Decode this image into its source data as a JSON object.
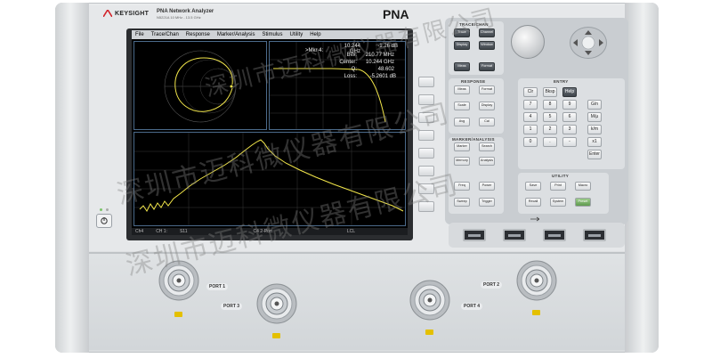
{
  "header": {
    "brand": "KEYSIGHT",
    "product": "PNA Network Analyzer",
    "model_line": "N5221A  10 MHz - 13.5 GHz",
    "badge": "PNA"
  },
  "menu": [
    "File",
    "Trace/Chan",
    "Response",
    "Marker/Analysis",
    "Stimulus",
    "Utility",
    "Help"
  ],
  "markers": {
    "title": ">Mkr 4:",
    "rows": [
      {
        "label": "",
        "value": "10.244 GHz",
        "extra": "-1.26 dB"
      },
      {
        "label": "BW:",
        "value": "210.77 MHz"
      },
      {
        "label": "Center:",
        "value": "10.244 GHz"
      },
      {
        "label": "Q:",
        "value": "48.602"
      },
      {
        "label": "Loss:",
        "value": "-5.2601 dB"
      }
    ]
  },
  "statusbar": {
    "left": "Ch4",
    "ch": "CH 1:",
    "param": "S11",
    "cal": "C4 2-Port",
    "lcl": "LCL"
  },
  "keys": {
    "trace_chan": [
      "Trace",
      "Channel",
      "Display",
      "Window",
      "Meas",
      "Format"
    ],
    "response": [
      "Meas",
      "Format",
      "Scale",
      "Display",
      "Avg",
      "Cal"
    ],
    "marker_analysis": [
      "Marker",
      "Search",
      "Memory",
      "Analysis"
    ],
    "stimulus": [
      "Freq",
      "Power",
      "Sweep",
      "Trigger"
    ],
    "entry": [
      "Clr",
      "Bksp",
      "Help",
      "7",
      "8",
      "9",
      "G/n",
      "4",
      "5",
      "6",
      "M/μ",
      "1",
      "2",
      "3",
      "k/m",
      "0",
      ".",
      "-",
      "x1",
      "Enter"
    ],
    "utility": [
      "Save",
      "Print",
      "Macro",
      "Recall",
      "System",
      "Preset"
    ]
  },
  "section_labels": {
    "trace_chan": "TRACE/CHAN",
    "response": "RESPONSE",
    "entry": "ENTRY",
    "marker": "MARKER/ANALYSIS",
    "utility": "UTILITY"
  },
  "ports": {
    "port1": "PORT 1",
    "port2": "PORT 2",
    "port3": "PORT 3",
    "port4": "PORT 4"
  },
  "watermark": [
    "深圳市迈科微仪器有限公司",
    "深圳市迈科微仪器有限公司",
    "深圳市迈科微仪器有限公司"
  ],
  "colors": {
    "trace": "#f2e64a",
    "screen_bg": "#000000",
    "preset_key": "#6aa55a"
  }
}
